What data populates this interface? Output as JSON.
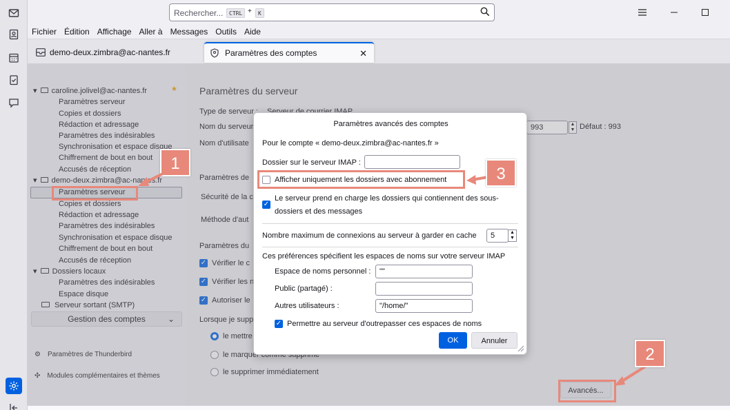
{
  "search": {
    "placeholder": "Rechercher...",
    "kbd_ctrl": "CTRL",
    "kbd_plus": "+",
    "kbd_k": "K"
  },
  "menu": [
    "Fichier",
    "Édition",
    "Affichage",
    "Aller à",
    "Messages",
    "Outils",
    "Aide"
  ],
  "tabs": [
    {
      "label": "demo-deux.zimbra@ac-nantes.fr"
    },
    {
      "label": "Paramètres des comptes",
      "close": "✕"
    }
  ],
  "tree": {
    "account1": "caroline.jolivel@ac-nantes.fr",
    "account1_items": [
      "Paramètres serveur",
      "Copies et dossiers",
      "Rédaction et adressage",
      "Paramètres des indésirables",
      "Synchronisation et espace disque",
      "Chiffrement de bout en bout",
      "Accusés de réception"
    ],
    "account2": "demo-deux.zimbra@ac-nantes.fr",
    "account2_items": [
      "Paramètres serveur",
      "Copies et dossiers",
      "Rédaction et adressage",
      "Paramètres des indésirables",
      "Synchronisation et espace disque",
      "Chiffrement de bout en bout",
      "Accusés de réception"
    ],
    "local": "Dossiers locaux",
    "local_items": [
      "Paramètres des indésirables",
      "Espace disque"
    ],
    "smtp": "Serveur sortant (SMTP)",
    "manage": "Gestion des comptes",
    "settings_link": "Paramètres de Thunderbird",
    "addons_link": "Modules complémentaires et thèmes"
  },
  "main": {
    "title": "Paramètres du serveur",
    "server_type_label": "Type de serveur :",
    "server_type_value": "Serveur de courrier IMAP",
    "server_name": "Nom du serveur",
    "user_name": "Nom d'utilisate",
    "port_value": "993",
    "default_port": "Défaut : 993",
    "security_section": "Paramètres de",
    "security": "Sécurité de la c",
    "auth": "Méthode d'aut",
    "server_section": "Paramètres du",
    "check1": "Vérifier le c",
    "check2": "Vérifier les n",
    "check3": "Autoriser le",
    "delete_label": "Lorsque je supp",
    "radio1": "le mettre",
    "radio2": "le marquer comme supprimé",
    "radio3": "le supprimer immédiatement",
    "advanced_button": "Avancés..."
  },
  "dialog": {
    "title": "Paramètres avancés des comptes",
    "for_account": "Pour le compte « demo-deux.zimbra@ac-nantes.fr »",
    "imap_folder_label": "Dossier sur le serveur IMAP :",
    "imap_folder_value": "",
    "only_subscribed": "Afficher uniquement les dossiers avec abonnement",
    "server_supports": "Le serveur prend en charge les dossiers qui contiennent des sous-",
    "server_supports_2": "dossiers et des messages",
    "max_conn_label": "Nombre maximum de connexions au serveur à garder en cache",
    "max_conn_value": "5",
    "namespace_intro": "Ces préférences spécifient les espaces de noms sur votre serveur IMAP",
    "personal_label": "Espace de noms personnel :",
    "personal_value": "\"\"",
    "public_label": "Public (partagé) :",
    "public_value": "",
    "others_label": "Autres utilisateurs :",
    "others_value": "\"/home/\"",
    "override": "Permettre au serveur d'outrepasser ces espaces de noms",
    "ok": "OK",
    "cancel": "Annuler"
  },
  "callouts": {
    "one": "1",
    "two": "2",
    "three": "3"
  },
  "colors": {
    "accent": "#0061e0",
    "callout": "#e8887a"
  }
}
